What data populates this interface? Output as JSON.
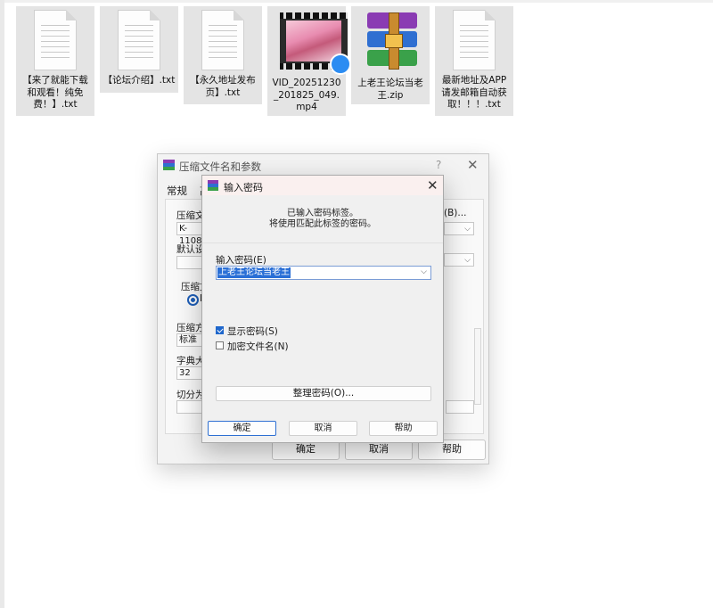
{
  "desktop": {
    "files": [
      {
        "label": "【来了就能下载和观看！纯免费！】.txt",
        "type": "text-file-icon"
      },
      {
        "label": "【论坛介绍】.txt",
        "type": "text-file-icon"
      },
      {
        "label": "【永久地址发布页】.txt",
        "type": "text-file-icon"
      },
      {
        "label": "VID_20251230_201825_049.mp4",
        "type": "video-file-icon"
      },
      {
        "label": "上老王论坛当老王.zip",
        "type": "winrar-archive-icon"
      },
      {
        "label": "最新地址及APP请发邮箱自动获取！！！.txt",
        "type": "text-file-icon"
      }
    ]
  },
  "background_dialog": {
    "title": "压缩文件名和参数",
    "help_glyph": "?",
    "close_glyph": "✕",
    "tab_general": "常规",
    "tab_partial": "高",
    "archive_name_label": "压缩文件",
    "archive_name_value": "K-1108",
    "browse_button": "(B)...",
    "default_settings_label": "默认设置",
    "format_label": "压缩文",
    "format_radio": "R",
    "method_label": "压缩方式",
    "method_value": "标准",
    "dict_label": "字典大小",
    "dict_value": "32",
    "split_label": "切分为分",
    "ok": "确定",
    "cancel": "取消",
    "help": "帮助"
  },
  "password_dialog": {
    "title": "输入密码",
    "close_glyph": "✕",
    "info_line1": "已输入密码标签。",
    "info_line2": "将使用匹配此标签的密码。",
    "password_label": "输入密码(E)",
    "password_value": "上老王论坛当老王",
    "show_password_label": "显示密码(S)",
    "show_password_checked": true,
    "encrypt_names_label": "加密文件名(N)",
    "encrypt_names_checked": false,
    "organize_button": "整理密码(O)...",
    "ok_button": "确定",
    "cancel_button": "取消",
    "help_button": "帮助"
  },
  "colors": {
    "accent": "#2a6fd6",
    "titlebar_tint": "#faf0ef",
    "tile_bg": "#e4e4e4"
  }
}
